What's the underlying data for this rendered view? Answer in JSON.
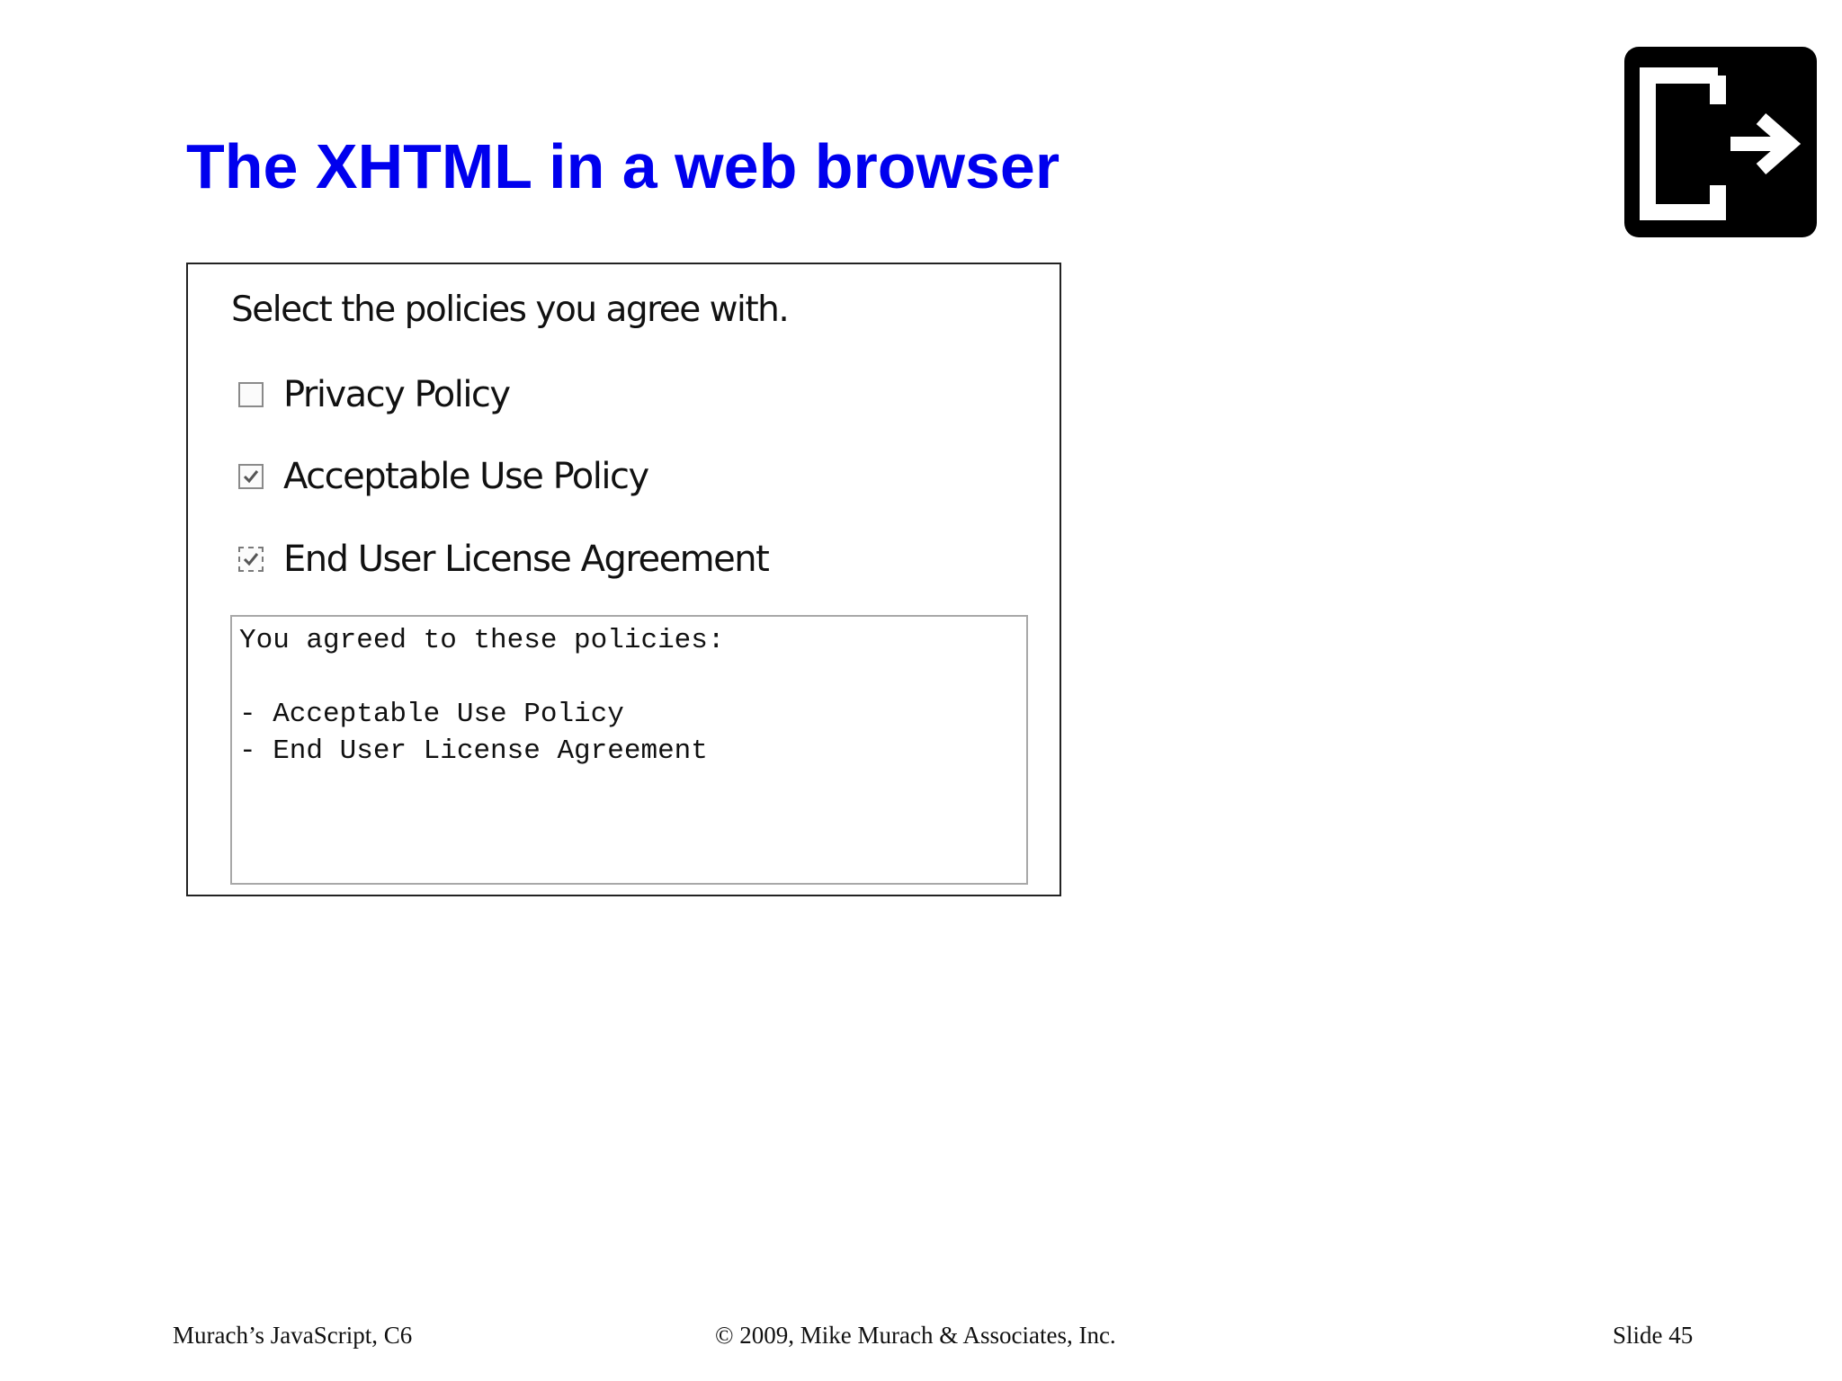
{
  "slide": {
    "title": "The XHTML in a web browser",
    "exit_button_icon": "exit-icon"
  },
  "browser": {
    "prompt": "Select the policies you agree with.",
    "policies": [
      {
        "label": "Privacy Policy",
        "checked": false
      },
      {
        "label": "Acceptable Use Policy",
        "checked": true
      },
      {
        "label": "End User License Agreement",
        "checked": true,
        "focused": true
      }
    ],
    "result_text": "You agreed to these policies:\n\n- Acceptable Use Policy\n- End User License Agreement"
  },
  "footer": {
    "left": "Murach’s JavaScript, C6",
    "center": "© 2009, Mike Murach & Associates, Inc.",
    "right": "Slide 45"
  },
  "colors": {
    "title": "#0000ee",
    "exit_button_bg": "#000000"
  }
}
